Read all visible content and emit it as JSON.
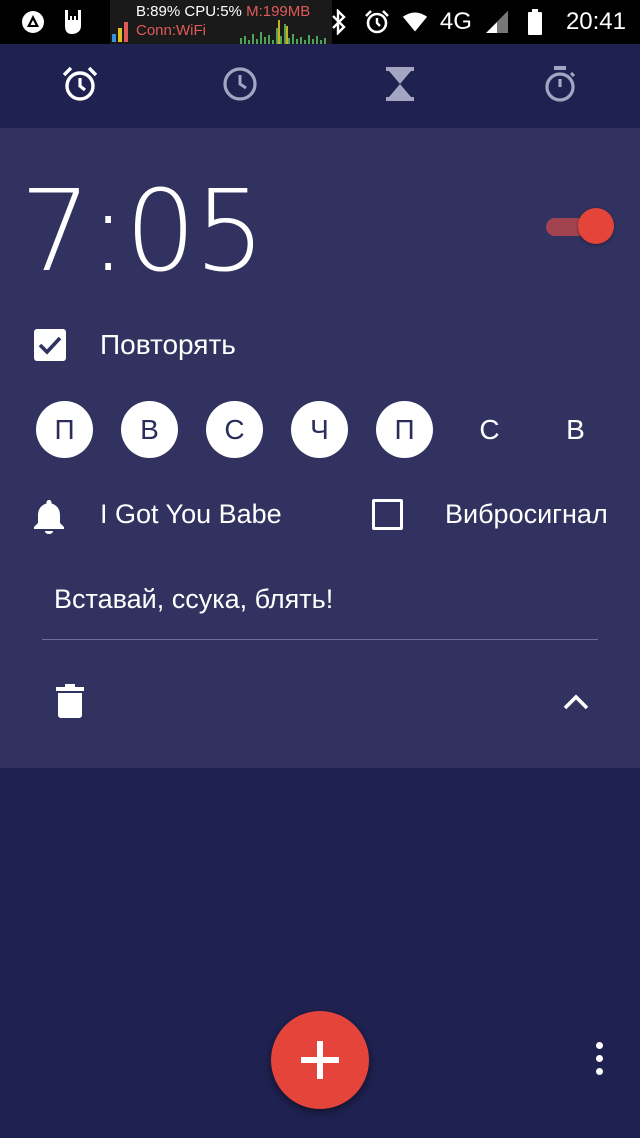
{
  "status_bar": {
    "monitor_line1_b": "B:89%",
    "monitor_line1_cpu": "CPU:5%",
    "monitor_line1_mem": "M:199MB",
    "monitor_line2": "Conn:WiFi",
    "network": "4G",
    "time": "20:41"
  },
  "tabs": [
    {
      "icon": "alarm-icon",
      "selected": true
    },
    {
      "icon": "clock-icon",
      "selected": false
    },
    {
      "icon": "timer-hourglass-icon",
      "selected": false
    },
    {
      "icon": "stopwatch-icon",
      "selected": false
    }
  ],
  "alarm": {
    "time": "7:05",
    "enabled": true,
    "repeat_checked": true,
    "repeat_label": "Повторять",
    "days": [
      {
        "label": "П",
        "on": true
      },
      {
        "label": "В",
        "on": true
      },
      {
        "label": "С",
        "on": true
      },
      {
        "label": "Ч",
        "on": true
      },
      {
        "label": "П",
        "on": true
      },
      {
        "label": "С",
        "on": false
      },
      {
        "label": "В",
        "on": false
      }
    ],
    "ringtone": "I Got You Babe",
    "vibrate_checked": false,
    "vibrate_label": "Вибросигнал",
    "label": "Вставай, ссука, блять!"
  },
  "colors": {
    "background": "#1f2150",
    "card": "#323260",
    "accent": "#e5443a"
  }
}
